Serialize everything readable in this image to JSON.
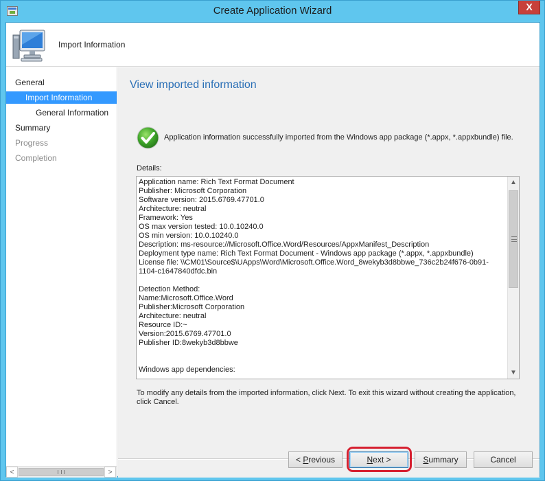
{
  "window": {
    "title": "Create Application Wizard",
    "close_label": "X"
  },
  "header": {
    "title": "Import Information",
    "icon": "computer-icon"
  },
  "sidebar": {
    "items": [
      {
        "label": "General",
        "state": "normal"
      },
      {
        "label": "Import Information",
        "state": "selected"
      },
      {
        "label": "General Information",
        "state": "normal"
      },
      {
        "label": "Summary",
        "state": "normal"
      },
      {
        "label": "Progress",
        "state": "disabled"
      },
      {
        "label": "Completion",
        "state": "disabled"
      }
    ],
    "scroll_left": "<",
    "scroll_right": ">"
  },
  "main": {
    "heading": "View imported information",
    "success_message": "Application information successfully imported from the Windows app package (*.appx, *.appxbundle) file.",
    "success_icon": "checkmark-icon",
    "details_label": "Details:",
    "details_lines": [
      "Application name: Rich Text Format Document",
      "Publisher: Microsoft Corporation",
      "Software version: 2015.6769.47701.0",
      "Architecture: neutral",
      "Framework: Yes",
      "OS max version tested: 10.0.10240.0",
      "OS min version: 10.0.10240.0",
      "Description: ms-resource://Microsoft.Office.Word/Resources/AppxManifest_Description",
      "Deployment type name: Rich Text Format Document - Windows app package (*.appx, *.appxbundle)",
      "License file: \\\\CM01\\Source$\\UApps\\Word\\Microsoft.Office.Word_8wekyb3d8bbwe_736c2b24f676-0b91-1104-c1647840dfdc.bin",
      "",
      "Detection Method:",
      "Name:Microsoft.Office.Word",
      "Publisher:Microsoft Corporation",
      "Architecture: neutral",
      "Resource ID:~",
      "Version:2015.6769.47701.0",
      "Publisher ID:8wekyb3d8bbwe",
      "",
      "",
      "Windows app dependencies:"
    ],
    "scroll_up": "▲",
    "scroll_down": "▼",
    "instructions": "To modify any details from the imported information, click Next. To exit this wizard without creating the application, click Cancel."
  },
  "buttons": {
    "previous": {
      "prefix": "< ",
      "accel": "P",
      "rest": "revious"
    },
    "next": {
      "accel": "N",
      "rest": "ext >"
    },
    "summary": {
      "accel": "S",
      "rest": "ummary"
    },
    "cancel": "Cancel"
  },
  "colors": {
    "titlebar": "#5fc6ee",
    "heading": "#2a6fb6",
    "selected_nav": "#3399ff",
    "highlight_ring": "#d62030",
    "close_button": "#c7403a"
  }
}
